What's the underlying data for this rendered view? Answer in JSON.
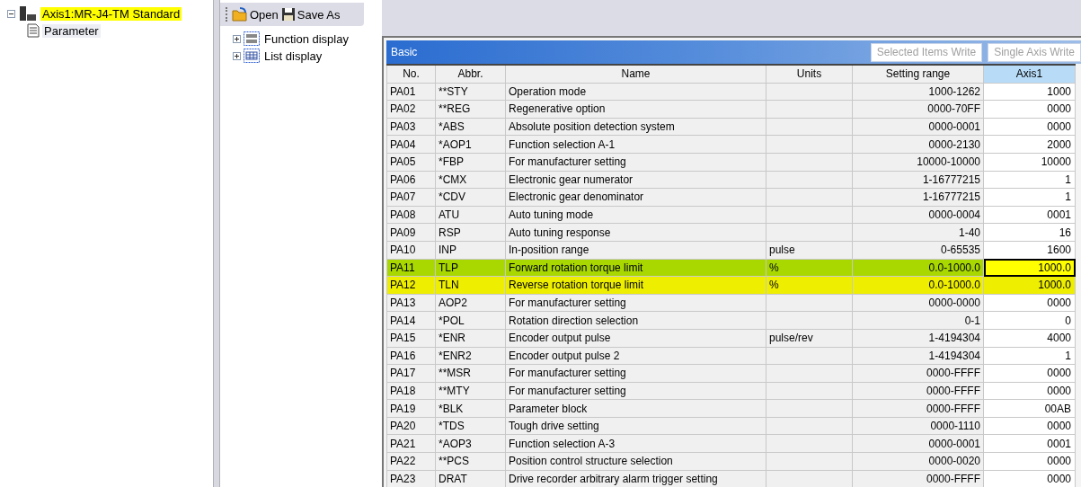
{
  "project_tree": {
    "label": "Axis1:MR-J4-TM Standard",
    "selected": true,
    "expanded": true,
    "children": [
      {
        "label": "Parameter",
        "selected": false
      }
    ]
  },
  "toolbar": [
    {
      "label": "Open",
      "kind": "open"
    },
    {
      "label": "Save As",
      "kind": "save"
    }
  ],
  "display_tree": [
    {
      "label": "Function display",
      "kind": "function",
      "expanded": false
    },
    {
      "label": "List display",
      "kind": "list",
      "expanded": false
    }
  ],
  "panel": {
    "title": "Basic",
    "buttons": [
      {
        "label": "Selected Items Write",
        "disabled": true
      },
      {
        "label": "Single Axis Write",
        "disabled": true
      }
    ],
    "columns": [
      "No.",
      "Abbr.",
      "Name",
      "Units",
      "Setting range",
      "Axis1"
    ],
    "rows": [
      {
        "no": "PA01",
        "abbr": "**STY",
        "name": "Operation mode",
        "units": "",
        "range": "1000-1262",
        "axis1": "1000",
        "selected": false
      },
      {
        "no": "PA02",
        "abbr": "**REG",
        "name": "Regenerative option",
        "units": "",
        "range": "0000-70FF",
        "axis1": "0000",
        "selected": false
      },
      {
        "no": "PA03",
        "abbr": "*ABS",
        "name": "Absolute position detection system",
        "units": "",
        "range": "0000-0001",
        "axis1": "0000",
        "selected": false
      },
      {
        "no": "PA04",
        "abbr": "*AOP1",
        "name": "Function selection A-1",
        "units": "",
        "range": "0000-2130",
        "axis1": "2000",
        "selected": false
      },
      {
        "no": "PA05",
        "abbr": "*FBP",
        "name": "For manufacturer setting",
        "units": "",
        "range": "10000-10000",
        "axis1": "10000",
        "selected": false
      },
      {
        "no": "PA06",
        "abbr": "*CMX",
        "name": "Electronic gear numerator",
        "units": "",
        "range": "1-16777215",
        "axis1": "1",
        "selected": false
      },
      {
        "no": "PA07",
        "abbr": "*CDV",
        "name": "Electronic gear denominator",
        "units": "",
        "range": "1-16777215",
        "axis1": "1",
        "selected": false
      },
      {
        "no": "PA08",
        "abbr": "ATU",
        "name": "Auto tuning mode",
        "units": "",
        "range": "0000-0004",
        "axis1": "0001",
        "selected": false
      },
      {
        "no": "PA09",
        "abbr": "RSP",
        "name": "Auto tuning response",
        "units": "",
        "range": "1-40",
        "axis1": "16",
        "selected": false
      },
      {
        "no": "PA10",
        "abbr": "INP",
        "name": "In-position range",
        "units": "pulse",
        "range": "0-65535",
        "axis1": "1600",
        "selected": false
      },
      {
        "no": "PA11",
        "abbr": "TLP",
        "name": "Forward rotation torque limit",
        "units": "%",
        "range": "0.0-1000.0",
        "axis1": "1000.0",
        "selected": true,
        "color": "#a8d800"
      },
      {
        "no": "PA12",
        "abbr": "TLN",
        "name": "Reverse rotation torque limit",
        "units": "%",
        "range": "0.0-1000.0",
        "axis1": "1000.0",
        "selected": false,
        "color": "#eeee00"
      },
      {
        "no": "PA13",
        "abbr": "AOP2",
        "name": "For manufacturer setting",
        "units": "",
        "range": "0000-0000",
        "axis1": "0000",
        "selected": false
      },
      {
        "no": "PA14",
        "abbr": "*POL",
        "name": "Rotation direction selection",
        "units": "",
        "range": "0-1",
        "axis1": "0",
        "selected": false
      },
      {
        "no": "PA15",
        "abbr": "*ENR",
        "name": "Encoder output pulse",
        "units": "pulse/rev",
        "range": "1-4194304",
        "axis1": "4000",
        "selected": false
      },
      {
        "no": "PA16",
        "abbr": "*ENR2",
        "name": "Encoder output pulse 2",
        "units": "",
        "range": "1-4194304",
        "axis1": "1",
        "selected": false
      },
      {
        "no": "PA17",
        "abbr": "**MSR",
        "name": "For manufacturer setting",
        "units": "",
        "range": "0000-FFFF",
        "axis1": "0000",
        "selected": false
      },
      {
        "no": "PA18",
        "abbr": "**MTY",
        "name": "For manufacturer setting",
        "units": "",
        "range": "0000-FFFF",
        "axis1": "0000",
        "selected": false
      },
      {
        "no": "PA19",
        "abbr": "*BLK",
        "name": "Parameter block",
        "units": "",
        "range": "0000-FFFF",
        "axis1": "00AB",
        "selected": false
      },
      {
        "no": "PA20",
        "abbr": "*TDS",
        "name": "Tough drive setting",
        "units": "",
        "range": "0000-1110",
        "axis1": "0000",
        "selected": false
      },
      {
        "no": "PA21",
        "abbr": "*AOP3",
        "name": "Function selection A-3",
        "units": "",
        "range": "0000-0001",
        "axis1": "0001",
        "selected": false
      },
      {
        "no": "PA22",
        "abbr": "**PCS",
        "name": "Position control structure selection",
        "units": "",
        "range": "0000-0020",
        "axis1": "0000",
        "selected": false
      },
      {
        "no": "PA23",
        "abbr": "DRAT",
        "name": "Drive recorder arbitrary alarm trigger setting",
        "units": "",
        "range": "0000-FFFF",
        "axis1": "0000",
        "selected": false
      }
    ]
  }
}
